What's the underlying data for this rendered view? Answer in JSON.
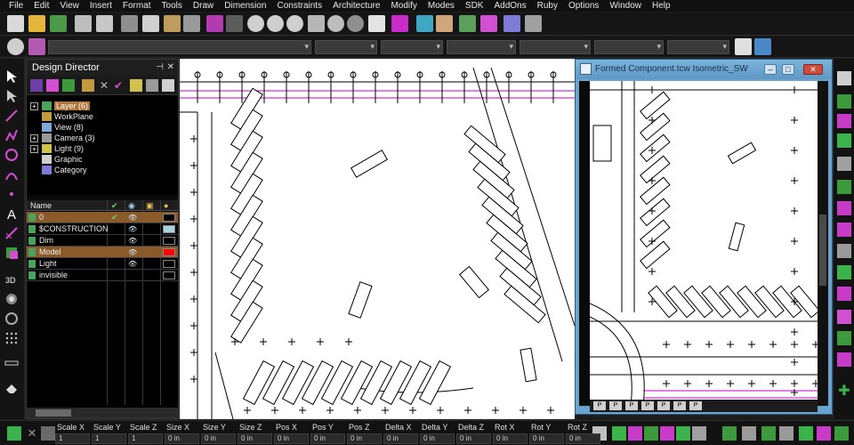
{
  "menu": [
    "File",
    "Edit",
    "View",
    "Insert",
    "Format",
    "Tools",
    "Draw",
    "Dimension",
    "Constraints",
    "Architecture",
    "Modify",
    "Modes",
    "SDK",
    "AddOns",
    "Ruby",
    "Options",
    "Window",
    "Help"
  ],
  "design_director": {
    "title": "Design Director",
    "pin": "📌",
    "close": "✕",
    "tree": [
      {
        "label": "Layer (6)",
        "expand": "+",
        "selected": true
      },
      {
        "label": "WorkPlane",
        "expand": "",
        "selected": false
      },
      {
        "label": "View (8)",
        "expand": "",
        "selected": false
      },
      {
        "label": "Camera (3)",
        "expand": "+",
        "selected": false
      },
      {
        "label": "Light (9)",
        "expand": "+",
        "selected": false
      },
      {
        "label": "Graphic",
        "expand": "",
        "selected": false
      },
      {
        "label": "Category",
        "expand": "",
        "selected": false
      }
    ],
    "grid_header": "Name",
    "layers": [
      {
        "name": "0",
        "selected": true,
        "check": "✔",
        "eye": "👁",
        "color": "#000000"
      },
      {
        "name": "$CONSTRUCTION",
        "selected": false,
        "check": "",
        "eye": "👁",
        "color": "#a9d3e0"
      },
      {
        "name": "Dim",
        "selected": false,
        "check": "",
        "eye": "👁",
        "color": "#000000"
      },
      {
        "name": "Model",
        "selected": true,
        "check": "",
        "eye": "👁",
        "color": "#ff0000"
      },
      {
        "name": "Light",
        "selected": false,
        "check": "",
        "eye": "👁",
        "color": "#000000"
      },
      {
        "name": "invisible",
        "selected": false,
        "check": "",
        "eye": "",
        "color": "#000000"
      }
    ]
  },
  "formed_component": {
    "title": "Formed Component.tcw Isometric_SW",
    "min": "–",
    "max": "□",
    "close": "✕",
    "tabs": [
      "P",
      "P",
      "P",
      "P",
      "P",
      "P",
      "P"
    ]
  },
  "statusbar": {
    "labels": [
      "Scale X",
      "Scale Y",
      "Scale Z",
      "Size X",
      "Size Y",
      "Size Z",
      "Pos X",
      "Pos Y",
      "Pos Z",
      "Delta X",
      "Delta Y",
      "Delta Z",
      "Rot X",
      "Rot Y",
      "Rot Z"
    ],
    "values": [
      "1",
      "1",
      "1",
      "0 in",
      "0 in",
      "0 in",
      "0 in",
      "0 in",
      "0 in",
      "0 in",
      "0 in",
      "0 in",
      "0 in",
      "0 in",
      "0 in"
    ]
  },
  "colors": {
    "accent_orange": "#b0763a",
    "magenta": "#c000c0",
    "window_blue": "#6aa3cc"
  }
}
